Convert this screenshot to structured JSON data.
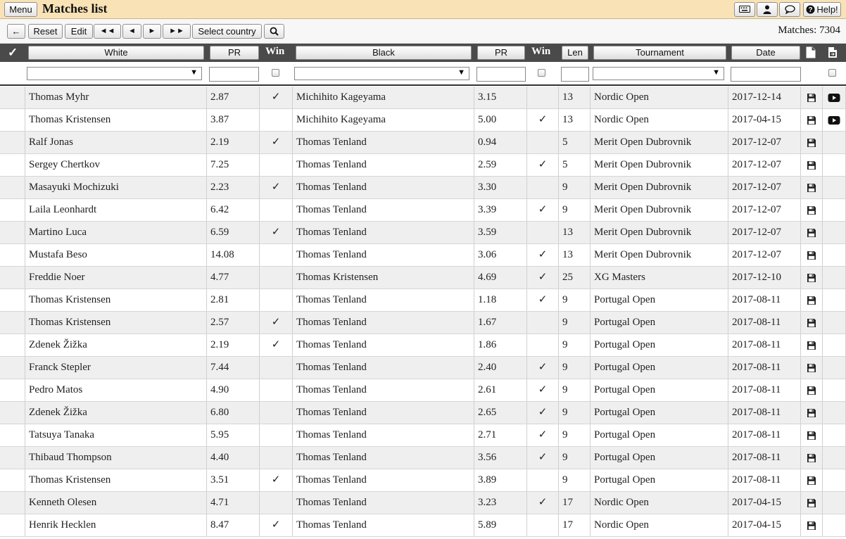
{
  "title_bar": {
    "menu_label": "Menu",
    "title": "Matches list",
    "help_label": "Help!"
  },
  "toolbar": {
    "back_label": "←",
    "reset_label": "Reset",
    "edit_label": "Edit",
    "first_label": "◄◄",
    "prev_label": "◄",
    "next_label": "►",
    "last_label": "►►",
    "select_country_label": "Select country",
    "matches_count": "Matches: 7304"
  },
  "header": {
    "check_mark": "✓",
    "white": "White",
    "pr_white": "PR",
    "win_white": "Win",
    "black": "Black",
    "pr_black": "PR",
    "win_black": "Win",
    "len": "Len",
    "tournament": "Tournament",
    "date": "Date"
  },
  "icons": {
    "keyboard": "keyboard-icon",
    "user": "user-icon",
    "chat": "chat-icon",
    "help": "help-circle-icon",
    "save": "floppy-disk-icon",
    "play": "play-video-icon",
    "document": "document-icon",
    "document_export": "document-export-icon",
    "search": "search-icon"
  },
  "rows": [
    {
      "white": "Thomas Myhr",
      "pr_w": "2.87",
      "win_w": "✓",
      "black": "Michihito Kageyama",
      "pr_b": "3.15",
      "win_b": "",
      "len": "13",
      "tournament": "Nordic Open",
      "date": "2017-12-14",
      "video": true
    },
    {
      "white": "Thomas Kristensen",
      "pr_w": "3.87",
      "win_w": "",
      "black": "Michihito Kageyama",
      "pr_b": "5.00",
      "win_b": "✓",
      "len": "13",
      "tournament": "Nordic Open",
      "date": "2017-04-15",
      "video": true
    },
    {
      "white": "Ralf Jonas",
      "pr_w": "2.19",
      "win_w": "✓",
      "black": "Thomas Tenland",
      "pr_b": "0.94",
      "win_b": "",
      "len": "5",
      "tournament": "Merit Open Dubrovnik",
      "date": "2017-12-07",
      "video": false
    },
    {
      "white": "Sergey Chertkov",
      "pr_w": "7.25",
      "win_w": "",
      "black": "Thomas Tenland",
      "pr_b": "2.59",
      "win_b": "✓",
      "len": "5",
      "tournament": "Merit Open Dubrovnik",
      "date": "2017-12-07",
      "video": false
    },
    {
      "white": "Masayuki Mochizuki",
      "pr_w": "2.23",
      "win_w": "✓",
      "black": "Thomas Tenland",
      "pr_b": "3.30",
      "win_b": "",
      "len": "9",
      "tournament": "Merit Open Dubrovnik",
      "date": "2017-12-07",
      "video": false
    },
    {
      "white": "Laila Leonhardt",
      "pr_w": "6.42",
      "win_w": "",
      "black": "Thomas Tenland",
      "pr_b": "3.39",
      "win_b": "✓",
      "len": "9",
      "tournament": "Merit Open Dubrovnik",
      "date": "2017-12-07",
      "video": false
    },
    {
      "white": "Martino Luca",
      "pr_w": "6.59",
      "win_w": "✓",
      "black": "Thomas Tenland",
      "pr_b": "3.59",
      "win_b": "",
      "len": "13",
      "tournament": "Merit Open Dubrovnik",
      "date": "2017-12-07",
      "video": false
    },
    {
      "white": "Mustafa Beso",
      "pr_w": "14.08",
      "win_w": "",
      "black": "Thomas Tenland",
      "pr_b": "3.06",
      "win_b": "✓",
      "len": "13",
      "tournament": "Merit Open Dubrovnik",
      "date": "2017-12-07",
      "video": false
    },
    {
      "white": "Freddie Noer",
      "pr_w": "4.77",
      "win_w": "",
      "black": "Thomas Kristensen",
      "pr_b": "4.69",
      "win_b": "✓",
      "len": "25",
      "tournament": "XG Masters",
      "date": "2017-12-10",
      "video": false
    },
    {
      "white": "Thomas Kristensen",
      "pr_w": "2.81",
      "win_w": "",
      "black": "Thomas Tenland",
      "pr_b": "1.18",
      "win_b": "✓",
      "len": "9",
      "tournament": "Portugal Open",
      "date": "2017-08-11",
      "video": false
    },
    {
      "white": "Thomas Kristensen",
      "pr_w": "2.57",
      "win_w": "✓",
      "black": "Thomas Tenland",
      "pr_b": "1.67",
      "win_b": "",
      "len": "9",
      "tournament": "Portugal Open",
      "date": "2017-08-11",
      "video": false
    },
    {
      "white": "Zdenek Žižka",
      "pr_w": "2.19",
      "win_w": "✓",
      "black": "Thomas Tenland",
      "pr_b": "1.86",
      "win_b": "",
      "len": "9",
      "tournament": "Portugal Open",
      "date": "2017-08-11",
      "video": false
    },
    {
      "white": "Franck Stepler",
      "pr_w": "7.44",
      "win_w": "",
      "black": "Thomas Tenland",
      "pr_b": "2.40",
      "win_b": "✓",
      "len": "9",
      "tournament": "Portugal Open",
      "date": "2017-08-11",
      "video": false
    },
    {
      "white": "Pedro Matos",
      "pr_w": "4.90",
      "win_w": "",
      "black": "Thomas Tenland",
      "pr_b": "2.61",
      "win_b": "✓",
      "len": "9",
      "tournament": "Portugal Open",
      "date": "2017-08-11",
      "video": false
    },
    {
      "white": "Zdenek Žižka",
      "pr_w": "6.80",
      "win_w": "",
      "black": "Thomas Tenland",
      "pr_b": "2.65",
      "win_b": "✓",
      "len": "9",
      "tournament": "Portugal Open",
      "date": "2017-08-11",
      "video": false
    },
    {
      "white": "Tatsuya Tanaka",
      "pr_w": "5.95",
      "win_w": "",
      "black": "Thomas Tenland",
      "pr_b": "2.71",
      "win_b": "✓",
      "len": "9",
      "tournament": "Portugal Open",
      "date": "2017-08-11",
      "video": false
    },
    {
      "white": "Thibaud Thompson",
      "pr_w": "4.40",
      "win_w": "",
      "black": "Thomas Tenland",
      "pr_b": "3.56",
      "win_b": "✓",
      "len": "9",
      "tournament": "Portugal Open",
      "date": "2017-08-11",
      "video": false
    },
    {
      "white": "Thomas Kristensen",
      "pr_w": "3.51",
      "win_w": "✓",
      "black": "Thomas Tenland",
      "pr_b": "3.89",
      "win_b": "",
      "len": "9",
      "tournament": "Portugal Open",
      "date": "2017-08-11",
      "video": false
    },
    {
      "white": "Kenneth Olesen",
      "pr_w": "4.71",
      "win_w": "",
      "black": "Thomas Tenland",
      "pr_b": "3.23",
      "win_b": "✓",
      "len": "17",
      "tournament": "Nordic Open",
      "date": "2017-04-15",
      "video": false
    },
    {
      "white": "Henrik Hecklen",
      "pr_w": "8.47",
      "win_w": "✓",
      "black": "Thomas Tenland",
      "pr_b": "5.89",
      "win_b": "",
      "len": "17",
      "tournament": "Nordic Open",
      "date": "2017-04-15",
      "video": false
    }
  ]
}
